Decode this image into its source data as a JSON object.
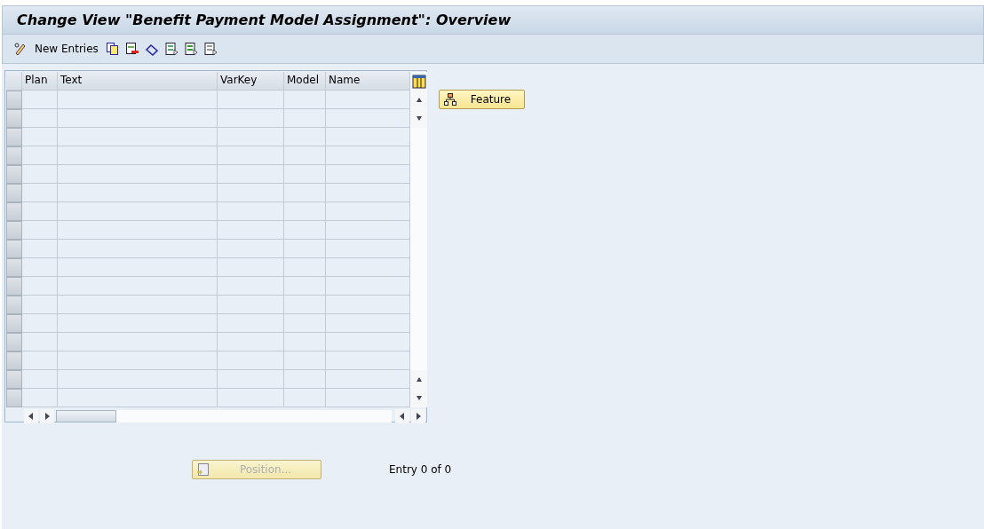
{
  "window": {
    "title": "Change View \"Benefit Payment Model Assignment\": Overview"
  },
  "toolbar": {
    "new_entries": "New Entries"
  },
  "table": {
    "columns": [
      "Plan",
      "Text",
      "VarKey",
      "Model",
      "Name"
    ]
  },
  "side_buttons": [
    {
      "label": "Feature",
      "disabled": false
    }
  ],
  "position_button": {
    "label": "Position...",
    "disabled": true
  },
  "entry_status": "Entry 0 of 0"
}
